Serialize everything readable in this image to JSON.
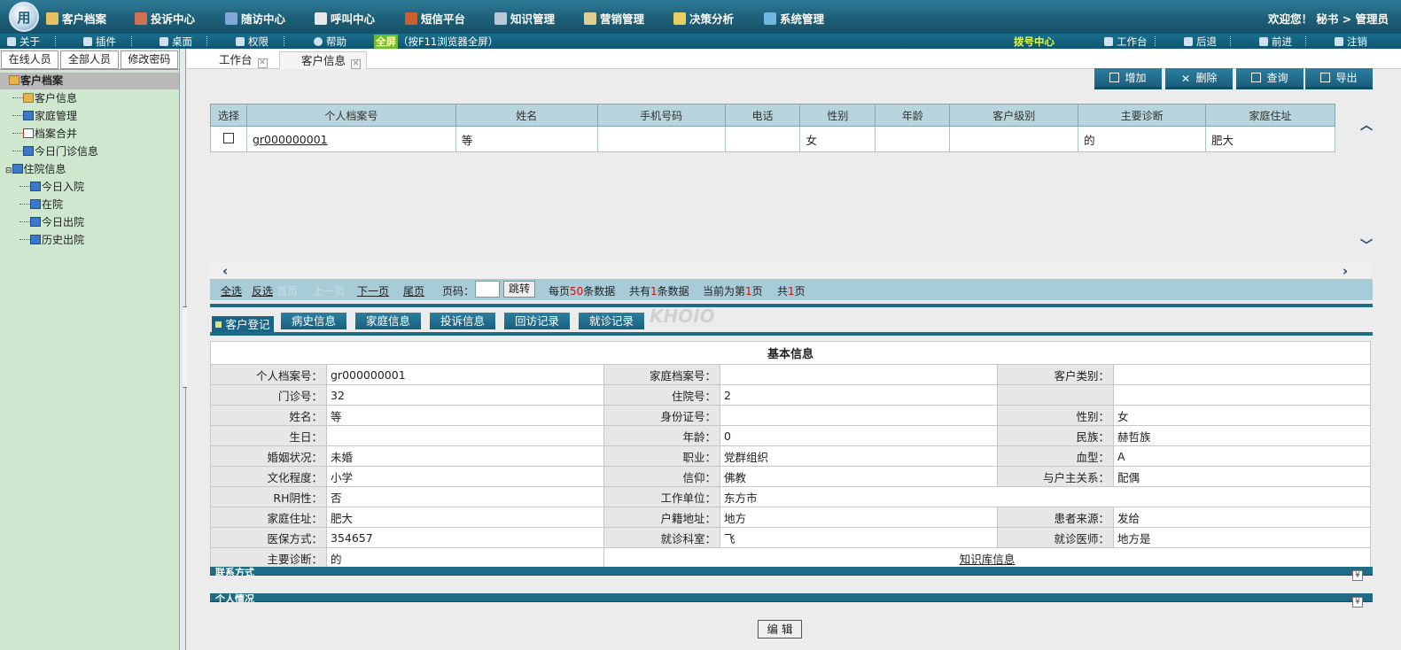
{
  "topnav": {
    "logo": "用",
    "items": [
      "客户档案",
      "投诉中心",
      "随访中心",
      "呼叫中心",
      "短信平台",
      "知识管理",
      "营销管理",
      "决策分析",
      "系统管理"
    ],
    "welcome": "欢迎您！ 秘书 > 管理员"
  },
  "subbar": {
    "items": [
      "关于",
      "插件",
      "桌面",
      "权限",
      "帮助"
    ],
    "fullscreen": "全屏",
    "fullscreen_hint": "（按F11浏览器全屏）",
    "hotline": "拨号中心",
    "right": [
      "工作台",
      "后退",
      "前进",
      "注销"
    ]
  },
  "left": {
    "tabs": [
      "在线人员",
      "全部人员",
      "修改密码"
    ],
    "root": "客户档案",
    "tree": [
      "客户信息",
      "家庭管理",
      "档案合并",
      "今日门诊信息",
      "住院信息",
      "今日入院",
      "在院",
      "今日出院",
      "历史出院"
    ]
  },
  "tabs": [
    "工作台",
    "客户信息"
  ],
  "toolbar": [
    "增加",
    "删除",
    "查询",
    "导出"
  ],
  "grid": {
    "headers": [
      "选择",
      "个人档案号",
      "姓名",
      "手机号码",
      "电话",
      "性别",
      "年龄",
      "客户级别",
      "主要诊断",
      "家庭住址"
    ],
    "row": [
      "",
      "gr000000001",
      "等",
      "",
      "",
      "女",
      "",
      "",
      "的",
      "肥大"
    ]
  },
  "pager": {
    "select_all": "全选",
    "invert": "反选",
    "first": "首页",
    "prev": "上一页",
    "next": "下一页",
    "last": "尾页",
    "page_label": "页码：",
    "jump": "跳转",
    "per_page_a": "每页",
    "per_page_n": "50",
    "per_page_b": "条数据",
    "total_a": "共有",
    "total_n": "1",
    "total_b": "条数据",
    "current_a": "当前为第",
    "current_n": "1",
    "current_b": "页",
    "pages_a": "共",
    "pages_n": "1",
    "pages_b": "页"
  },
  "detail_tabs": [
    "客户登记",
    "病史信息",
    "家庭信息",
    "投诉信息",
    "回访记录",
    "就诊记录"
  ],
  "watermark": "KHOIO",
  "info": {
    "title": "基本信息",
    "rows": [
      [
        "个人档案号：",
        "gr000000001",
        "家庭档案号：",
        "",
        "客户类别：",
        ""
      ],
      [
        "门诊号：",
        "32",
        "住院号：",
        "2",
        "",
        ""
      ],
      [
        "姓名：",
        "等",
        "身份证号：",
        "",
        "性别：",
        "女"
      ],
      [
        "生日：",
        "",
        "年龄：",
        "0",
        "民族：",
        "赫哲族"
      ],
      [
        "婚姻状况：",
        "未婚",
        "职业：",
        "党群组织",
        "血型：",
        "A"
      ],
      [
        "文化程度：",
        "小学",
        "信仰：",
        "佛教",
        "与户主关系：",
        "配偶"
      ],
      [
        "RH阴性：",
        "否",
        "工作单位：",
        "东方市"
      ],
      [
        "家庭住址：",
        "肥大",
        "户籍地址：",
        "地方",
        "患者来源：",
        "发给"
      ],
      [
        "医保方式：",
        "354657",
        "就诊科室：",
        "飞",
        "就诊医师：",
        "地方是"
      ],
      [
        "主要诊断：",
        "的",
        "知识库信息"
      ]
    ]
  },
  "sections": [
    "联系方式",
    "个人情况"
  ],
  "edit_button": "编 辑",
  "colors": {
    "nav": "#1d5f78",
    "accent": "#1e6c86",
    "tree_bg": "#cfe7cf"
  }
}
